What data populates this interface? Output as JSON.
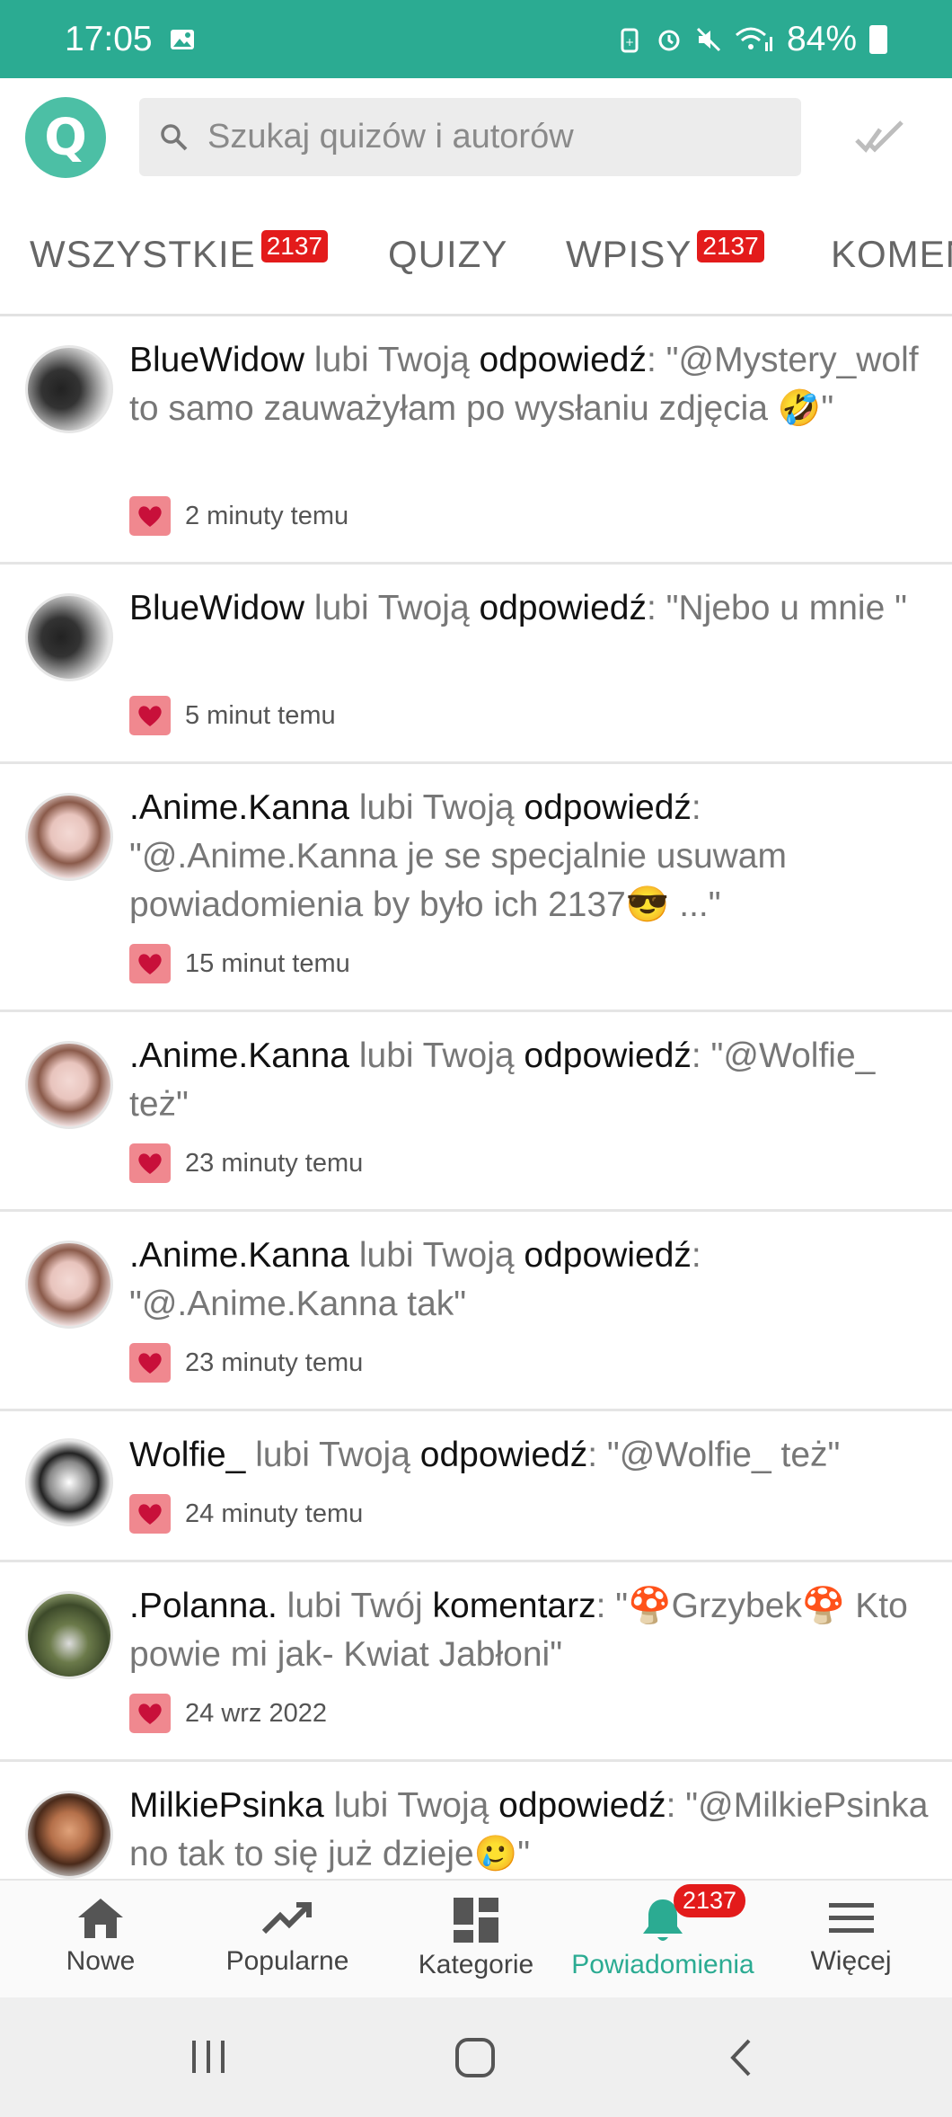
{
  "status_bar": {
    "time": "17:05",
    "battery": "84%"
  },
  "search": {
    "placeholder": "Szukaj quizów i autorów"
  },
  "logo": {
    "letter": "Q"
  },
  "tabs": [
    {
      "label": "WSZYSTKIE",
      "badge": "2137"
    },
    {
      "label": "QUIZY"
    },
    {
      "label": "WPISY",
      "badge": "2137"
    },
    {
      "label": "KOMENTARZE"
    }
  ],
  "notifications": [
    {
      "user": "BlueWidow",
      "action": "lubi Twoją",
      "object": "odpowiedź",
      "text": ": \"@Mystery_wolf to samo zauważyłam po wysłaniu zdjęcia 🤣\"",
      "time": "2 minuty temu"
    },
    {
      "user": "BlueWidow",
      "action": "lubi Twoją",
      "object": "odpowiedź",
      "text": ": \"Njebo u mnie \"",
      "time": "5 minut temu"
    },
    {
      "user": ".Anime.Kanna",
      "action": "lubi Twoją",
      "object": "odpowiedź",
      "text": ": \"@.Anime.Kanna je se specjalnie usuwam powiadomienia by było ich 2137😎 ...\"",
      "time": "15 minut temu"
    },
    {
      "user": ".Anime.Kanna",
      "action": "lubi Twoją",
      "object": "odpowiedź",
      "text": ": \"@Wolfie_ też\"",
      "time": "23 minuty temu"
    },
    {
      "user": ".Anime.Kanna",
      "action": "lubi Twoją",
      "object": "odpowiedź",
      "text": ": \"@.Anime.Kanna tak\"",
      "time": "23 minuty temu"
    },
    {
      "user": "Wolfie_",
      "action": "lubi Twoją",
      "object": "odpowiedź",
      "text": ": \"@Wolfie_ też\"",
      "time": "24 minuty temu"
    },
    {
      "user": ".Polanna.",
      "action": "lubi Twój",
      "object": "komentarz",
      "text": ": \"🍄Grzybek🍄 Kto powie mi jak- Kwiat Jabłoni\"",
      "time": "24 wrz 2022"
    },
    {
      "user": "MilkiePsinka",
      "action": "lubi Twoją",
      "object": "odpowiedź",
      "text": ": \"@MilkiePsinka no tak to się już dzieje🥲\"",
      "time": ""
    }
  ],
  "bottom_nav": [
    {
      "label": "Nowe",
      "icon": "home-icon"
    },
    {
      "label": "Popularne",
      "icon": "trending-icon"
    },
    {
      "label": "Kategorie",
      "icon": "categories-icon"
    },
    {
      "label": "Powiadomienia",
      "icon": "bell-icon",
      "badge": "2137",
      "active": true
    },
    {
      "label": "Więcej",
      "icon": "menu-icon"
    }
  ],
  "colors": {
    "primary": "#2bab92",
    "badge": "#e31b1b",
    "heart_bg": "#f0888f",
    "heart": "#c8103a"
  }
}
